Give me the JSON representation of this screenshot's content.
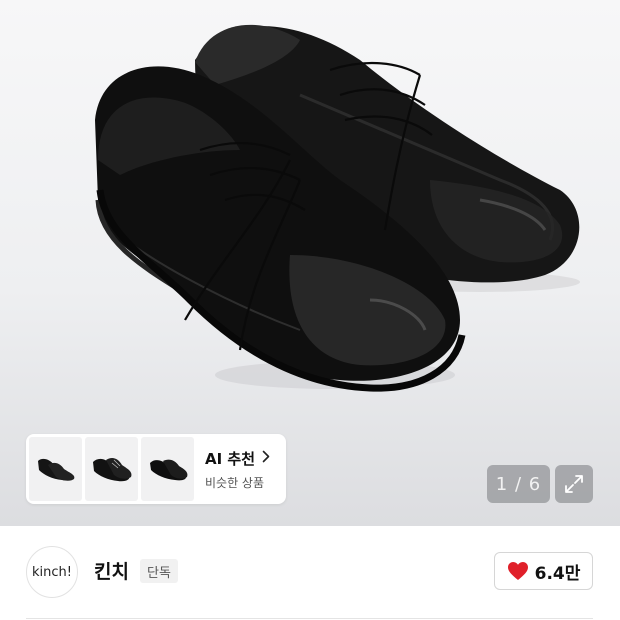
{
  "product_image": {
    "subject": "black-leather-derby-shoes",
    "pager_text": "1 / 6",
    "current_page": 1,
    "total_pages": 6
  },
  "ai_recommend": {
    "title": "AI 추천",
    "subtitle": "비슷한 상품",
    "thumbnails": [
      "shoe-thumbnail",
      "shoe-thumbnail",
      "shoe-thumbnail"
    ]
  },
  "brand": {
    "logo_text": "kinch!",
    "name": "킨치",
    "tag": "단독"
  },
  "likes": {
    "count": "6.4만",
    "heart_color": "#e0202a"
  },
  "icons": {
    "expand": "expand-icon",
    "heart": "heart-icon",
    "chevron": "chevron-right-icon"
  }
}
